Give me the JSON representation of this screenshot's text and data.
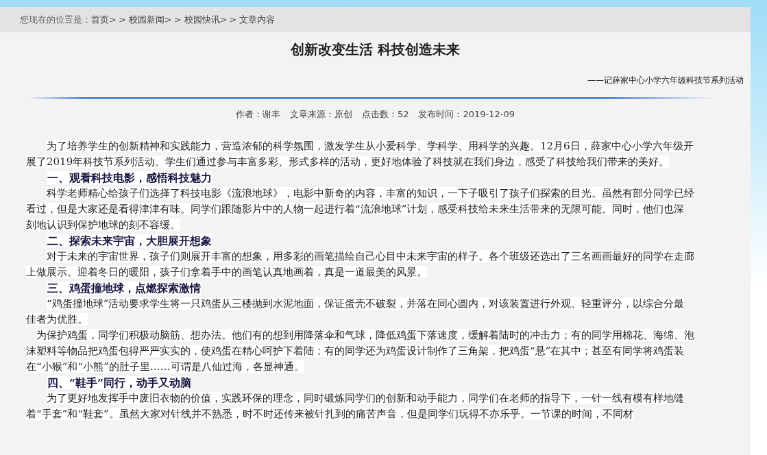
{
  "breadcrumb": {
    "label": "您现在的位置是：",
    "items": [
      {
        "text": "首页"
      },
      {
        "text": ">>"
      },
      {
        "text": "校园新闻"
      },
      {
        "text": ">>"
      },
      {
        "text": "校园快讯"
      },
      {
        "text": ">>"
      },
      {
        "text": "文章内容"
      }
    ]
  },
  "title": "创新改变生活 科技创造未来",
  "subtitle": "——记薛家中心小学六年级科技节系列活动",
  "meta": [
    {
      "label": "作者：",
      "value": "谢丰"
    },
    {
      "label": "文章来源：",
      "value": "原创"
    },
    {
      "label": "点击数：",
      "value": "52"
    },
    {
      "label": "发布时间：",
      "value": "2019-12-09"
    }
  ],
  "content": [
    {
      "kind": "paragraph",
      "text": "为了培养学生的创新精神和实践能力，营造浓郁的科学氛围，激发学生从小爱科学、学科学、用科学的兴趣。12月6日，薛家中心小学六年级开展了2019年科技节系列活动。学生们通过参与丰富多彩、形式多样的活动，更好地体验了科技就在我们身边，感受了科技给我们带来的美好。"
    },
    {
      "kind": "heading",
      "text": "一、观看科技电影，感悟科技魅力"
    },
    {
      "kind": "paragraph",
      "text": "科学老师精心给孩子们选择了科技电影《流浪地球》，电影中新奇的内容，丰富的知识，一下子吸引了孩子们探索的目光。虽然有部分同学已经看过，但是大家还是看得津津有味。同学们跟随影片中的人物一起进行着“流浪地球”计划，感受科技给未来生活带来的无限可能。同时，他们也深刻地认识到保护地球的刻不容缓。"
    },
    {
      "kind": "heading",
      "text": "二、探索未来宇宙，大胆展开想象"
    },
    {
      "kind": "paragraph",
      "text": "对于未来的宇宙世界，孩子们则展开丰富的想象，用多彩的画笔描绘自己心目中未来宇宙的样子。各个班级还选出了三名画画最好的同学在走廊上做展示。迎着冬日的暖阳，孩子们拿着手中的画笔认真地画着，真是一道最美的风景。"
    },
    {
      "kind": "heading",
      "text": "三、鸡蛋撞地球，点燃探索激情"
    },
    {
      "kind": "paragraph",
      "text": "“鸡蛋撞地球”活动要求学生将一只鸡蛋从三楼抛到水泥地面，保证蛋壳不破裂，并落在同心圆内，对该装置进行外观、轻重评分，以综合分最佳者为优胜。"
    },
    {
      "kind": "short-indent",
      "text": "为保护鸡蛋，同学们积极动脑筋、想办法。他们有的想到用降落伞和气球，降低鸡蛋下落速度，缓解着陆时的冲击力；有的同学用棉花、海绵、泡沫塑料等物品把鸡蛋包得严严实实的，使鸡蛋在精心呵护下着陆；有的同学还为鸡蛋设计制作了三角架，把鸡蛋“悬”在其中；甚至有同学将鸡蛋装在“小猴”和“小熊”的肚子里……可谓是八仙过海，各显神通。"
    },
    {
      "kind": "heading",
      "text": "四、“鞋手”同行，动手又动脑"
    },
    {
      "kind": "paragraph",
      "text": "为了更好地发挥手中废旧衣物的价值，实践环保的理念，同时锻炼同学们的创新和动手能力，同学们在老师的指导下，一针一线有模有样地缝着“手套”和“鞋套”。虽然大家对针线并不熟悉，时不时还传来被针扎到的痛苦声音，但是同学们玩得不亦乐乎。一节课的时间，不同材"
    }
  ]
}
